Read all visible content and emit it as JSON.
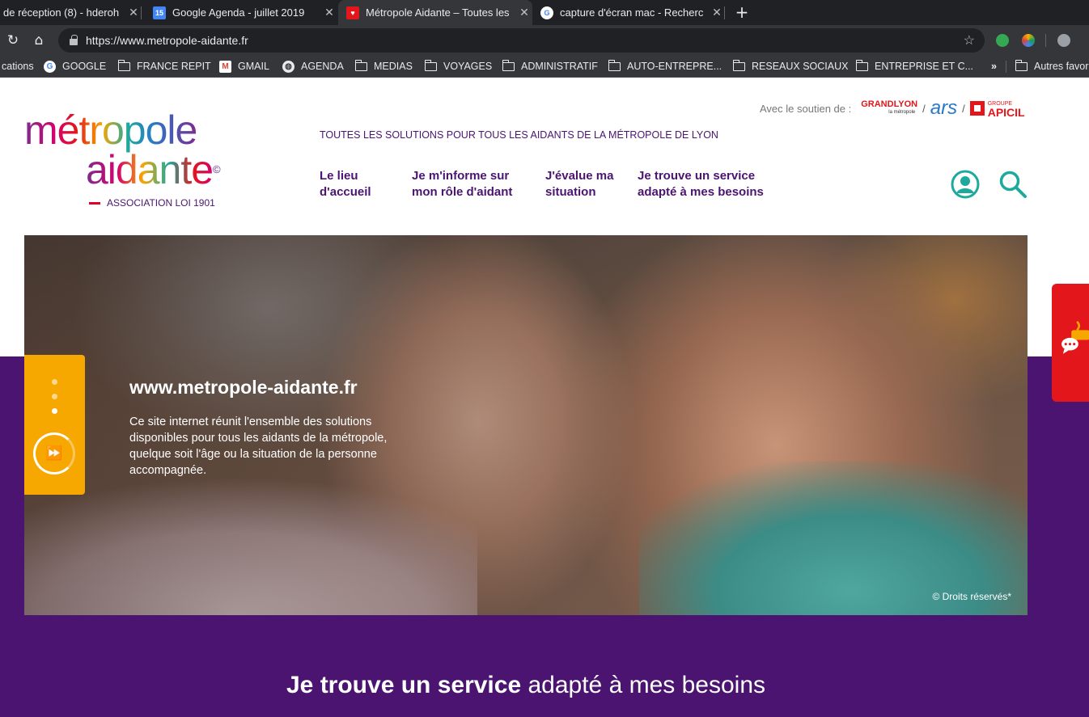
{
  "browser": {
    "tabs": [
      {
        "title": "de réception (8) - hderoh",
        "icon": "gmail-icon"
      },
      {
        "title": "Google Agenda - juillet 2019",
        "icon": "calendar-icon",
        "badge": "15"
      },
      {
        "title": "Métropole Aidante – Toutes les",
        "icon": "site-icon"
      },
      {
        "title": "capture d'écran mac - Recherc",
        "icon": "google-icon"
      }
    ],
    "new_tab": "+",
    "url": "https://www.metropole-aidante.fr",
    "bookmarks": [
      {
        "label": "cations",
        "icon": "apps"
      },
      {
        "label": "GOOGLE",
        "icon": "google-icon"
      },
      {
        "label": "FRANCE REPIT",
        "icon": "folder-icon"
      },
      {
        "label": "GMAIL",
        "icon": "gmail-icon"
      },
      {
        "label": "AGENDA",
        "icon": "globe-icon"
      },
      {
        "label": "MEDIAS",
        "icon": "folder-icon"
      },
      {
        "label": "VOYAGES",
        "icon": "folder-icon"
      },
      {
        "label": "ADMINISTRATIF",
        "icon": "folder-icon"
      },
      {
        "label": "AUTO-ENTREPRE...",
        "icon": "folder-icon"
      },
      {
        "label": "RESEAUX SOCIAUX",
        "icon": "folder-icon"
      },
      {
        "label": "ENTREPRISE ET C...",
        "icon": "folder-icon"
      }
    ],
    "overflow": "»",
    "other_bookmarks": "Autres favor"
  },
  "header": {
    "logo_line1": "métropole",
    "logo_line2": "aidante",
    "logo_copy": "©",
    "logo_sub": "ASSOCIATION LOI 1901",
    "support_label": "Avec le soutien de :",
    "partners": [
      "GRANDLYON",
      "ars",
      "APICIL"
    ],
    "partner_apicil_group": "GROUPE",
    "partner_grandlyon_sub": "la métropole",
    "separator": "/",
    "tagline": "TOUTES LES SOLUTIONS POUR TOUS LES AIDANTS DE LA MÉTROPOLE DE LYON",
    "nav": [
      {
        "line1": "Le lieu",
        "line2": "d'accueil"
      },
      {
        "line1": "Je m'informe sur",
        "line2": "mon rôle d'aidant"
      },
      {
        "line1": "J'évalue ma",
        "line2": "situation"
      },
      {
        "line1": "Je trouve un service",
        "line2": "adapté à mes besoins"
      }
    ]
  },
  "hero": {
    "title": "www.metropole-aidante.fr",
    "text": "Ce site internet réunit l'ensemble des solutions disponibles pour tous les aidants de la métropole, quelque soit l'âge ou la situation de la personne accompagnée.",
    "credit": "© Droits réservés*",
    "slides_total": 3,
    "slide_active": 3
  },
  "section": {
    "title_bold": "Je trouve un service",
    "title_rest": " adapté à mes besoins"
  },
  "colors": {
    "purple": "#4a1470",
    "orange": "#f7a800",
    "red": "#e3161b",
    "teal": "#1ea99d"
  }
}
